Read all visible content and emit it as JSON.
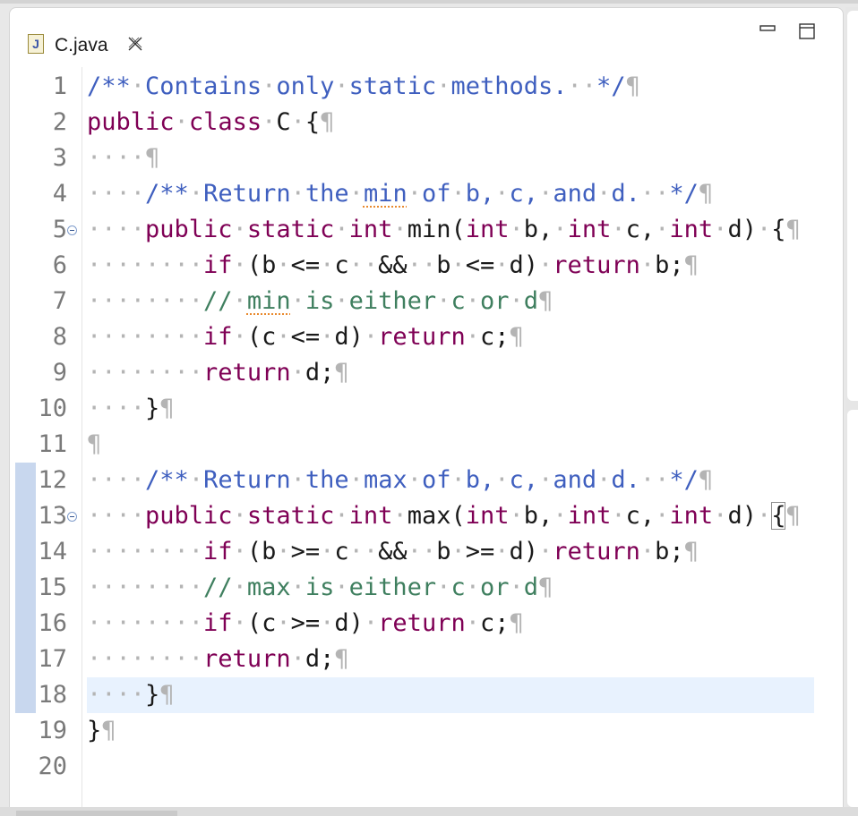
{
  "editor": {
    "tab": {
      "icon_letter": "J",
      "title": "C.java"
    },
    "lines": [
      {
        "num": "1",
        "segments": [
          {
            "t": "/**",
            "c": "doc"
          },
          {
            "t": "·",
            "c": "ws"
          },
          {
            "t": "Contains",
            "c": "doc"
          },
          {
            "t": "·",
            "c": "ws"
          },
          {
            "t": "only",
            "c": "doc"
          },
          {
            "t": "·",
            "c": "ws"
          },
          {
            "t": "static",
            "c": "doc"
          },
          {
            "t": "·",
            "c": "ws"
          },
          {
            "t": "methods.",
            "c": "doc"
          },
          {
            "t": "··",
            "c": "ws"
          },
          {
            "t": "*/",
            "c": "doc"
          },
          {
            "t": "¶",
            "c": "pil"
          }
        ]
      },
      {
        "num": "2",
        "segments": [
          {
            "t": "public",
            "c": "kw"
          },
          {
            "t": "·",
            "c": "ws"
          },
          {
            "t": "class",
            "c": "kw"
          },
          {
            "t": "·",
            "c": "ws"
          },
          {
            "t": "C",
            "c": ""
          },
          {
            "t": "·",
            "c": "ws"
          },
          {
            "t": "{",
            "c": ""
          },
          {
            "t": "¶",
            "c": "pil"
          }
        ]
      },
      {
        "num": "3",
        "segments": [
          {
            "t": "····",
            "c": "ws"
          },
          {
            "t": "¶",
            "c": "pil"
          }
        ]
      },
      {
        "num": "4",
        "segments": [
          {
            "t": "····",
            "c": "ws"
          },
          {
            "t": "/**",
            "c": "doc"
          },
          {
            "t": "·",
            "c": "ws"
          },
          {
            "t": "Return",
            "c": "doc"
          },
          {
            "t": "·",
            "c": "ws"
          },
          {
            "t": "the",
            "c": "doc"
          },
          {
            "t": "·",
            "c": "ws"
          },
          {
            "t": "min",
            "c": "doc spell"
          },
          {
            "t": "·",
            "c": "ws"
          },
          {
            "t": "of",
            "c": "doc"
          },
          {
            "t": "·",
            "c": "ws"
          },
          {
            "t": "b,",
            "c": "doc"
          },
          {
            "t": "·",
            "c": "ws"
          },
          {
            "t": "c,",
            "c": "doc"
          },
          {
            "t": "·",
            "c": "ws"
          },
          {
            "t": "and",
            "c": "doc"
          },
          {
            "t": "·",
            "c": "ws"
          },
          {
            "t": "d.",
            "c": "doc"
          },
          {
            "t": "··",
            "c": "ws"
          },
          {
            "t": "*/",
            "c": "doc"
          },
          {
            "t": "¶",
            "c": "pil"
          }
        ]
      },
      {
        "num": "5",
        "fold": true,
        "segments": [
          {
            "t": "····",
            "c": "ws"
          },
          {
            "t": "public",
            "c": "kw"
          },
          {
            "t": "·",
            "c": "ws"
          },
          {
            "t": "static",
            "c": "kw"
          },
          {
            "t": "·",
            "c": "ws"
          },
          {
            "t": "int",
            "c": "kw"
          },
          {
            "t": "·",
            "c": "ws"
          },
          {
            "t": "min(",
            "c": ""
          },
          {
            "t": "int",
            "c": "kw"
          },
          {
            "t": "·",
            "c": "ws"
          },
          {
            "t": "b,",
            "c": ""
          },
          {
            "t": "·",
            "c": "ws"
          },
          {
            "t": "int",
            "c": "kw"
          },
          {
            "t": "·",
            "c": "ws"
          },
          {
            "t": "c,",
            "c": ""
          },
          {
            "t": "·",
            "c": "ws"
          },
          {
            "t": "int",
            "c": "kw"
          },
          {
            "t": "·",
            "c": "ws"
          },
          {
            "t": "d)",
            "c": ""
          },
          {
            "t": "·",
            "c": "ws"
          },
          {
            "t": "{",
            "c": ""
          },
          {
            "t": "¶",
            "c": "pil"
          }
        ]
      },
      {
        "num": "6",
        "segments": [
          {
            "t": "········",
            "c": "ws"
          },
          {
            "t": "if",
            "c": "kw"
          },
          {
            "t": "·",
            "c": "ws"
          },
          {
            "t": "(b",
            "c": ""
          },
          {
            "t": "·",
            "c": "ws"
          },
          {
            "t": "<=",
            "c": ""
          },
          {
            "t": "·",
            "c": "ws"
          },
          {
            "t": "c",
            "c": ""
          },
          {
            "t": "··",
            "c": "ws"
          },
          {
            "t": "&&",
            "c": ""
          },
          {
            "t": "··",
            "c": "ws"
          },
          {
            "t": "b",
            "c": ""
          },
          {
            "t": "·",
            "c": "ws"
          },
          {
            "t": "<=",
            "c": ""
          },
          {
            "t": "·",
            "c": "ws"
          },
          {
            "t": "d)",
            "c": ""
          },
          {
            "t": "·",
            "c": "ws"
          },
          {
            "t": "return",
            "c": "kw"
          },
          {
            "t": "·",
            "c": "ws"
          },
          {
            "t": "b;",
            "c": ""
          },
          {
            "t": "¶",
            "c": "pil"
          }
        ]
      },
      {
        "num": "7",
        "segments": [
          {
            "t": "········",
            "c": "ws"
          },
          {
            "t": "//",
            "c": "cmt"
          },
          {
            "t": "·",
            "c": "ws"
          },
          {
            "t": "min",
            "c": "cmt spell"
          },
          {
            "t": "·",
            "c": "ws"
          },
          {
            "t": "is",
            "c": "cmt"
          },
          {
            "t": "·",
            "c": "ws"
          },
          {
            "t": "either",
            "c": "cmt"
          },
          {
            "t": "·",
            "c": "ws"
          },
          {
            "t": "c",
            "c": "cmt"
          },
          {
            "t": "·",
            "c": "ws"
          },
          {
            "t": "or",
            "c": "cmt"
          },
          {
            "t": "·",
            "c": "ws"
          },
          {
            "t": "d",
            "c": "cmt"
          },
          {
            "t": "¶",
            "c": "pil"
          }
        ]
      },
      {
        "num": "8",
        "segments": [
          {
            "t": "········",
            "c": "ws"
          },
          {
            "t": "if",
            "c": "kw"
          },
          {
            "t": "·",
            "c": "ws"
          },
          {
            "t": "(c",
            "c": ""
          },
          {
            "t": "·",
            "c": "ws"
          },
          {
            "t": "<=",
            "c": ""
          },
          {
            "t": "·",
            "c": "ws"
          },
          {
            "t": "d)",
            "c": ""
          },
          {
            "t": "·",
            "c": "ws"
          },
          {
            "t": "return",
            "c": "kw"
          },
          {
            "t": "·",
            "c": "ws"
          },
          {
            "t": "c;",
            "c": ""
          },
          {
            "t": "¶",
            "c": "pil"
          }
        ]
      },
      {
        "num": "9",
        "segments": [
          {
            "t": "········",
            "c": "ws"
          },
          {
            "t": "return",
            "c": "kw"
          },
          {
            "t": "·",
            "c": "ws"
          },
          {
            "t": "d;",
            "c": ""
          },
          {
            "t": "¶",
            "c": "pil"
          }
        ]
      },
      {
        "num": "10",
        "segments": [
          {
            "t": "····",
            "c": "ws"
          },
          {
            "t": "}",
            "c": ""
          },
          {
            "t": "¶",
            "c": "pil"
          }
        ]
      },
      {
        "num": "11",
        "segments": [
          {
            "t": "¶",
            "c": "pil"
          }
        ]
      },
      {
        "num": "12",
        "segments": [
          {
            "t": "····",
            "c": "ws"
          },
          {
            "t": "/**",
            "c": "doc"
          },
          {
            "t": "·",
            "c": "ws"
          },
          {
            "t": "Return",
            "c": "doc"
          },
          {
            "t": "·",
            "c": "ws"
          },
          {
            "t": "the",
            "c": "doc"
          },
          {
            "t": "·",
            "c": "ws"
          },
          {
            "t": "max",
            "c": "doc"
          },
          {
            "t": "·",
            "c": "ws"
          },
          {
            "t": "of",
            "c": "doc"
          },
          {
            "t": "·",
            "c": "ws"
          },
          {
            "t": "b,",
            "c": "doc"
          },
          {
            "t": "·",
            "c": "ws"
          },
          {
            "t": "c,",
            "c": "doc"
          },
          {
            "t": "·",
            "c": "ws"
          },
          {
            "t": "and",
            "c": "doc"
          },
          {
            "t": "·",
            "c": "ws"
          },
          {
            "t": "d.",
            "c": "doc"
          },
          {
            "t": "··",
            "c": "ws"
          },
          {
            "t": "*/",
            "c": "doc"
          },
          {
            "t": "¶",
            "c": "pil"
          }
        ]
      },
      {
        "num": "13",
        "fold": true,
        "segments": [
          {
            "t": "····",
            "c": "ws"
          },
          {
            "t": "public",
            "c": "kw"
          },
          {
            "t": "·",
            "c": "ws"
          },
          {
            "t": "static",
            "c": "kw"
          },
          {
            "t": "·",
            "c": "ws"
          },
          {
            "t": "int",
            "c": "kw"
          },
          {
            "t": "·",
            "c": "ws"
          },
          {
            "t": "max(",
            "c": ""
          },
          {
            "t": "int",
            "c": "kw"
          },
          {
            "t": "·",
            "c": "ws"
          },
          {
            "t": "b,",
            "c": ""
          },
          {
            "t": "·",
            "c": "ws"
          },
          {
            "t": "int",
            "c": "kw"
          },
          {
            "t": "·",
            "c": "ws"
          },
          {
            "t": "c,",
            "c": ""
          },
          {
            "t": "·",
            "c": "ws"
          },
          {
            "t": "int",
            "c": "kw"
          },
          {
            "t": "·",
            "c": "ws"
          },
          {
            "t": "d)",
            "c": ""
          },
          {
            "t": "·",
            "c": "ws"
          },
          {
            "t": "{",
            "c": "bracket"
          },
          {
            "t": "¶",
            "c": "pil"
          }
        ]
      },
      {
        "num": "14",
        "segments": [
          {
            "t": "········",
            "c": "ws"
          },
          {
            "t": "if",
            "c": "kw"
          },
          {
            "t": "·",
            "c": "ws"
          },
          {
            "t": "(b",
            "c": ""
          },
          {
            "t": "·",
            "c": "ws"
          },
          {
            "t": ">=",
            "c": ""
          },
          {
            "t": "·",
            "c": "ws"
          },
          {
            "t": "c",
            "c": ""
          },
          {
            "t": "··",
            "c": "ws"
          },
          {
            "t": "&&",
            "c": ""
          },
          {
            "t": "··",
            "c": "ws"
          },
          {
            "t": "b",
            "c": ""
          },
          {
            "t": "·",
            "c": "ws"
          },
          {
            "t": ">=",
            "c": ""
          },
          {
            "t": "·",
            "c": "ws"
          },
          {
            "t": "d)",
            "c": ""
          },
          {
            "t": "·",
            "c": "ws"
          },
          {
            "t": "return",
            "c": "kw"
          },
          {
            "t": "·",
            "c": "ws"
          },
          {
            "t": "b;",
            "c": ""
          },
          {
            "t": "¶",
            "c": "pil"
          }
        ]
      },
      {
        "num": "15",
        "segments": [
          {
            "t": "········",
            "c": "ws"
          },
          {
            "t": "//",
            "c": "cmt"
          },
          {
            "t": "·",
            "c": "ws"
          },
          {
            "t": "max",
            "c": "cmt"
          },
          {
            "t": "·",
            "c": "ws"
          },
          {
            "t": "is",
            "c": "cmt"
          },
          {
            "t": "·",
            "c": "ws"
          },
          {
            "t": "either",
            "c": "cmt"
          },
          {
            "t": "·",
            "c": "ws"
          },
          {
            "t": "c",
            "c": "cmt"
          },
          {
            "t": "·",
            "c": "ws"
          },
          {
            "t": "or",
            "c": "cmt"
          },
          {
            "t": "·",
            "c": "ws"
          },
          {
            "t": "d",
            "c": "cmt"
          },
          {
            "t": "¶",
            "c": "pil"
          }
        ]
      },
      {
        "num": "16",
        "segments": [
          {
            "t": "········",
            "c": "ws"
          },
          {
            "t": "if",
            "c": "kw"
          },
          {
            "t": "·",
            "c": "ws"
          },
          {
            "t": "(c",
            "c": ""
          },
          {
            "t": "·",
            "c": "ws"
          },
          {
            "t": ">=",
            "c": ""
          },
          {
            "t": "·",
            "c": "ws"
          },
          {
            "t": "d)",
            "c": ""
          },
          {
            "t": "·",
            "c": "ws"
          },
          {
            "t": "return",
            "c": "kw"
          },
          {
            "t": "·",
            "c": "ws"
          },
          {
            "t": "c;",
            "c": ""
          },
          {
            "t": "¶",
            "c": "pil"
          }
        ]
      },
      {
        "num": "17",
        "segments": [
          {
            "t": "········",
            "c": "ws"
          },
          {
            "t": "return",
            "c": "kw"
          },
          {
            "t": "·",
            "c": "ws"
          },
          {
            "t": "d;",
            "c": ""
          },
          {
            "t": "¶",
            "c": "pil"
          }
        ]
      },
      {
        "num": "18",
        "current": true,
        "segments": [
          {
            "t": "····",
            "c": "ws"
          },
          {
            "t": "}",
            "c": ""
          },
          {
            "t": "¶",
            "c": "pil"
          }
        ]
      },
      {
        "num": "19",
        "segments": [
          {
            "t": "}",
            "c": ""
          },
          {
            "t": "¶",
            "c": "pil"
          }
        ]
      },
      {
        "num": "20",
        "segments": []
      }
    ]
  },
  "colors": {
    "keyword": "#7f0055",
    "javadoc": "#3f5fbf",
    "comment": "#3f7f5f",
    "whitespace": "#b4b4b4",
    "current_line": "#e8f2fe",
    "change_ruler": "#c8d7ee"
  },
  "icons": {
    "tab": "java-file-icon",
    "close": "close-x-icon",
    "minimize": "minimize-icon",
    "maximize": "maximize-icon",
    "fold": "fold-collapse-icon"
  }
}
